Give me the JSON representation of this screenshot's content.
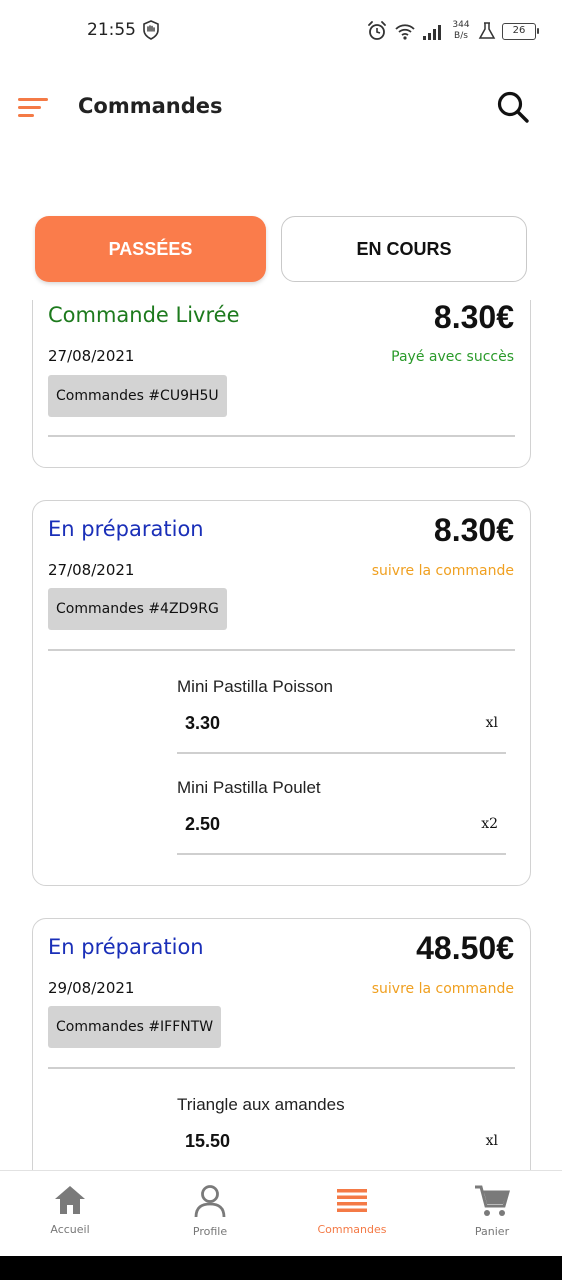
{
  "status_bar": {
    "time": "21:55",
    "net_speed_value": "344",
    "net_speed_unit": "B/s",
    "battery": "26"
  },
  "header": {
    "title": "Commandes"
  },
  "tabs": [
    {
      "label": "PASSÉES",
      "active": true
    },
    {
      "label": "EN COURS",
      "active": false
    }
  ],
  "orders": [
    {
      "status": "Commande Livrée",
      "total": "8.30€",
      "date": "27/08/2021",
      "status_link": "Payé avec succès",
      "reference": "Commandes #CU9H5U",
      "items": []
    },
    {
      "status": "En préparation",
      "total": "8.30€",
      "date": "27/08/2021",
      "status_link": "suivre la commande",
      "reference": "Commandes #4ZD9RG",
      "items": [
        {
          "name": "Mini Pastilla Poisson",
          "price": "3.30",
          "qty": "xl"
        },
        {
          "name": "Mini Pastilla Poulet",
          "price": "2.50",
          "qty": "x2"
        }
      ]
    },
    {
      "status": "En préparation",
      "total": "48.50€",
      "date": "29/08/2021",
      "status_link": "suivre la commande",
      "reference": "Commandes #IFFNTW",
      "items": [
        {
          "name": "Triangle aux amandes",
          "price": "15.50",
          "qty": "xl"
        }
      ]
    }
  ],
  "bottom_nav": [
    {
      "label": "Accueil",
      "icon": "home-icon",
      "active": false
    },
    {
      "label": "Profile",
      "icon": "user-icon",
      "active": false
    },
    {
      "label": "Commandes",
      "icon": "list-icon",
      "active": true
    },
    {
      "label": "Panier",
      "icon": "cart-icon",
      "active": false
    }
  ],
  "colors": {
    "accent": "#fa7c4b",
    "delivered": "#1d7a1d",
    "preparation": "#1a2fb8",
    "paid": "#2a9a2a",
    "follow": "#f0a020"
  }
}
